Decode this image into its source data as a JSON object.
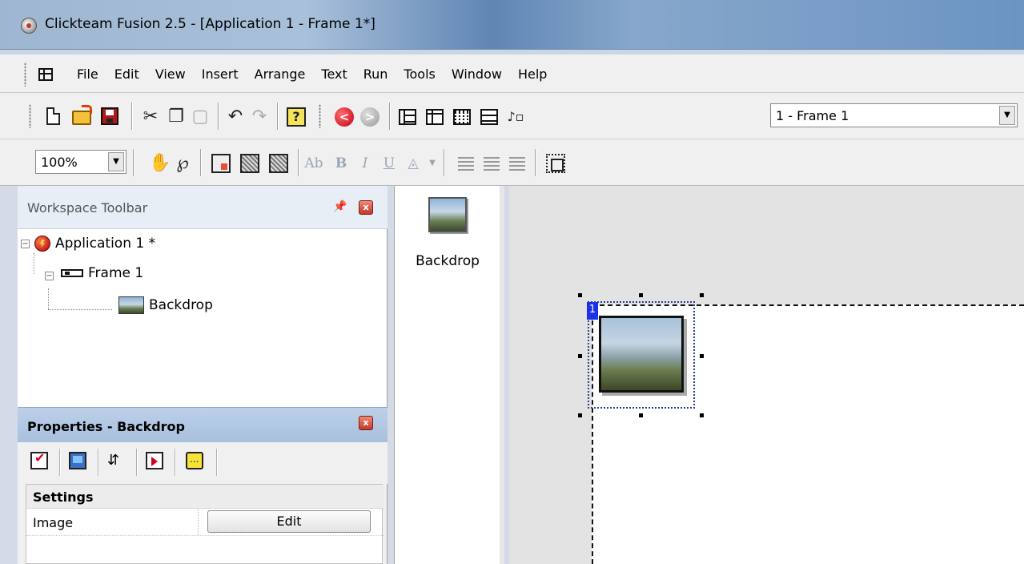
{
  "window": {
    "title": "Clickteam Fusion 2.5 - [Application 1 - Frame 1*]"
  },
  "menu": {
    "items": [
      "File",
      "Edit",
      "View",
      "Insert",
      "Arrange",
      "Text",
      "Run",
      "Tools",
      "Window",
      "Help"
    ]
  },
  "toolbar": {
    "frame_selector_value": "1 - Frame 1",
    "zoom_value": "100%"
  },
  "workspace": {
    "title": "Workspace Toolbar",
    "pin_glyph": "ᵖ",
    "close_glyph": "x",
    "tree": {
      "application": "Application 1 *",
      "frame": "Frame 1",
      "object": "Backdrop"
    }
  },
  "properties": {
    "title": "Properties - Backdrop",
    "close_glyph": "x",
    "category": "Settings",
    "rows": [
      {
        "key": "Image",
        "button": "Edit"
      }
    ]
  },
  "library": {
    "items": [
      {
        "label": "Backdrop",
        "icon": "backdrop-thumbnail-icon"
      }
    ]
  },
  "frame_editor": {
    "selected_object_number": "1",
    "selected_object": "Backdrop"
  },
  "colors": {
    "object_number_badge": "#1a33e8",
    "close_button": "#c0392b"
  }
}
